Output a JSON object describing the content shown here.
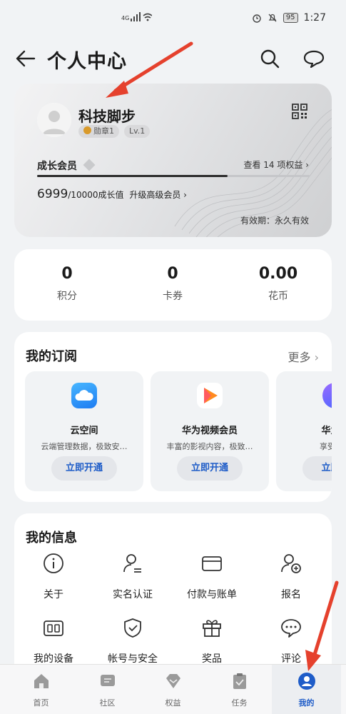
{
  "status_bar": {
    "network": "4G",
    "battery": "95",
    "time": "1:27"
  },
  "header": {
    "title": "个人中心"
  },
  "member_card": {
    "username": "科技脚步",
    "medal_badge": "勋章1",
    "level_badge": "Lv.1",
    "tier": "成长会员",
    "view_benefits": "查看 14 项权益 ›",
    "growth_value": "6999",
    "growth_total": "/10000成长值",
    "upgrade": "升级高级会员 ›",
    "validity": "有效期：永久有效",
    "progress": 0.6999
  },
  "stats": [
    {
      "value": "0",
      "label": "积分"
    },
    {
      "value": "0",
      "label": "卡券"
    },
    {
      "value": "0.00",
      "label": "花币"
    }
  ],
  "subscriptions": {
    "title": "我的订阅",
    "more": "更多",
    "items": [
      {
        "name": "云空间",
        "desc": "云端管理数据，极致安…",
        "button": "立即开通"
      },
      {
        "name": "华为视频会员",
        "desc": "丰富的影视内容，极致…",
        "button": "立即开通"
      },
      {
        "name": "华为音",
        "desc": "享受高品",
        "button": "立即开"
      }
    ]
  },
  "my_info": {
    "title": "我的信息",
    "items": [
      {
        "label": "关于"
      },
      {
        "label": "实名认证"
      },
      {
        "label": "付款与账单"
      },
      {
        "label": "报名"
      },
      {
        "label": "我的设备"
      },
      {
        "label": "帐号与安全"
      },
      {
        "label": "奖品"
      },
      {
        "label": "评论"
      }
    ]
  },
  "bottom_nav": [
    {
      "label": "首页"
    },
    {
      "label": "社区"
    },
    {
      "label": "权益"
    },
    {
      "label": "任务"
    },
    {
      "label": "我的"
    }
  ],
  "colors": {
    "accent": "#1e5cc8",
    "annotation_arrow": "#e5412d"
  }
}
